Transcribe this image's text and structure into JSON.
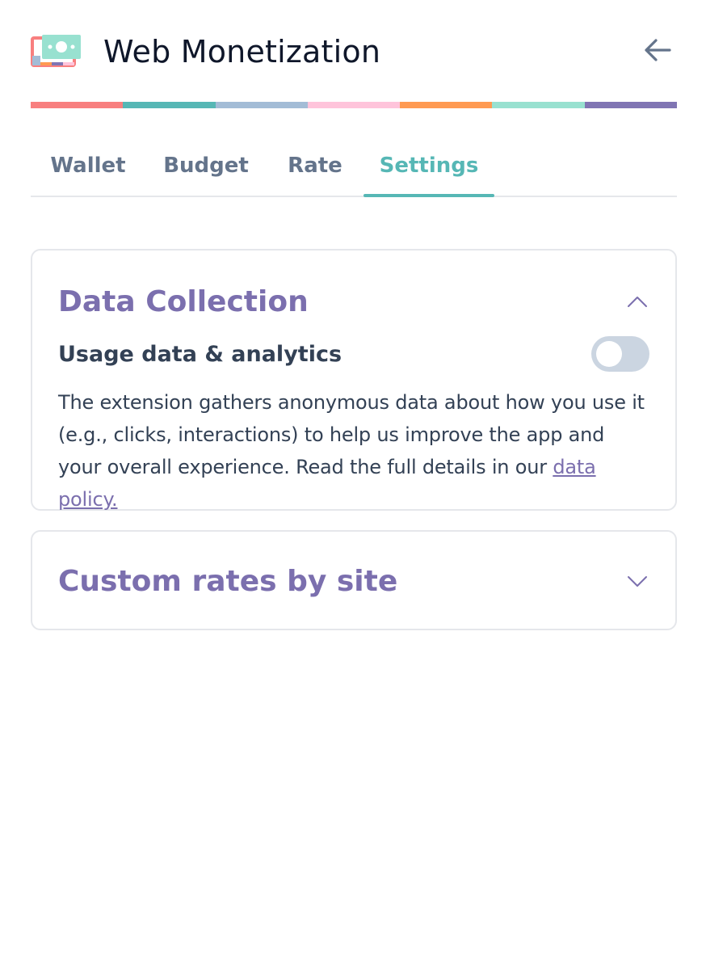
{
  "header": {
    "title": "Web Monetization",
    "logo_icon": "money-bill-logo-icon",
    "back_icon": "arrow-left-icon"
  },
  "colors": {
    "accent_teal": "#56b7b5",
    "accent_purple": "#7b6fae",
    "rainbow": [
      "#f87f7f",
      "#56b7b5",
      "#a3bcd6",
      "#ffc4db",
      "#ff9a52",
      "#98e1d0",
      "#8075b3"
    ]
  },
  "tabs": [
    {
      "label": "Wallet",
      "active": false
    },
    {
      "label": "Budget",
      "active": false
    },
    {
      "label": "Rate",
      "active": false
    },
    {
      "label": "Settings",
      "active": true
    }
  ],
  "data_collection": {
    "title": "Data Collection",
    "expanded": true,
    "chevron_icon": "chevron-up-icon",
    "setting_label": "Usage data & analytics",
    "toggle_on": false,
    "description": "The extension gathers anonymous data about how you use it (e.g., clicks, interactions) to help us improve the app and your overall experience. Read the full details in our ",
    "link_text": "data policy."
  },
  "custom_rates": {
    "title": "Custom rates by site",
    "expanded": false,
    "chevron_icon": "chevron-down-icon"
  }
}
